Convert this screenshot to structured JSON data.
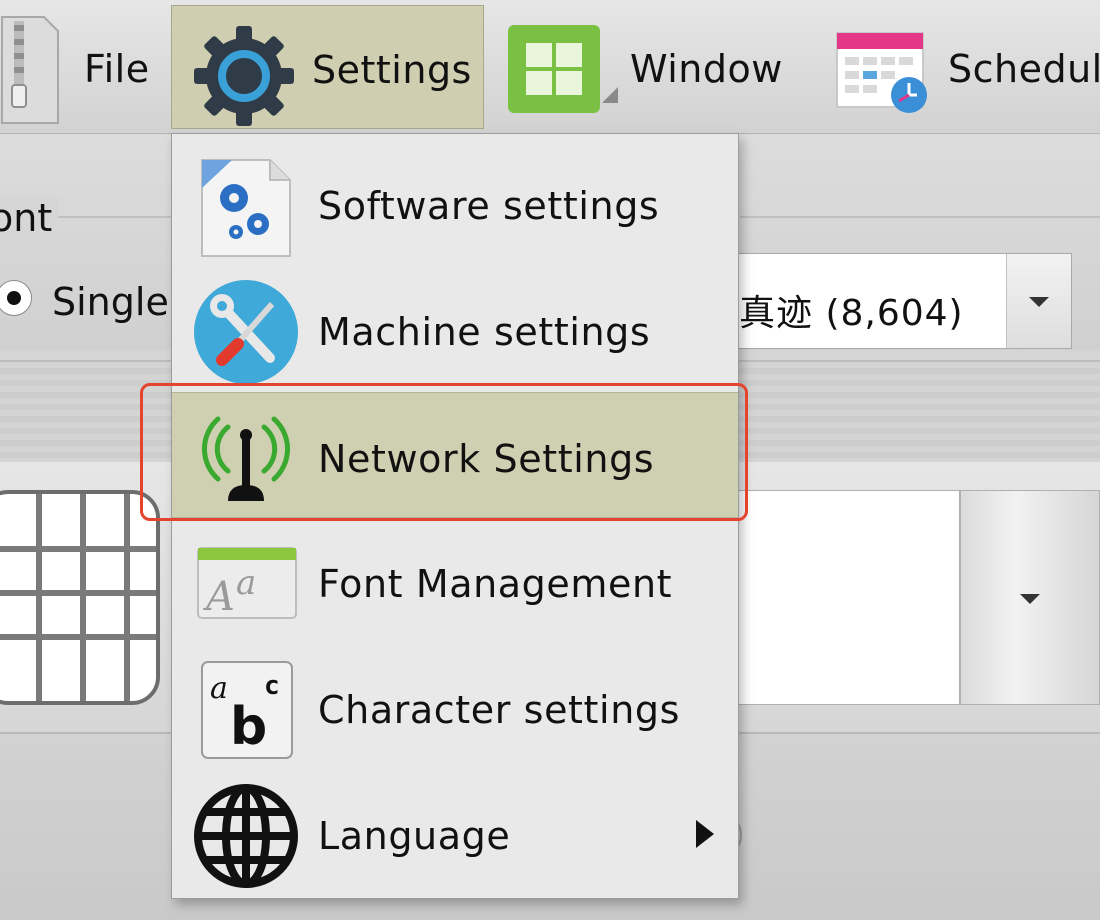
{
  "menubar": {
    "items": [
      {
        "label": "File",
        "icon": "zip-file-icon"
      },
      {
        "label": "Settings",
        "icon": "gear-icon",
        "active": true
      },
      {
        "label": "Window",
        "icon": "windows-logo-icon"
      },
      {
        "label": "Schedul",
        "icon": "calendar-clock-icon"
      }
    ]
  },
  "background": {
    "font_group_label": "ont",
    "radio_label": "Single",
    "font_combo_value": "真迹 (8,604)"
  },
  "settings_menu": {
    "items": [
      {
        "label": "Software settings",
        "icon": "software-gears-icon"
      },
      {
        "label": "Machine settings",
        "icon": "wrench-screwdriver-icon"
      },
      {
        "label": "Network Settings",
        "icon": "antenna-icon",
        "highlighted": true
      },
      {
        "label": "Font Management",
        "icon": "font-aa-icon"
      },
      {
        "label": "Character settings",
        "icon": "abc-icon"
      },
      {
        "label": "Language",
        "icon": "globe-icon",
        "has_submenu": true
      }
    ]
  },
  "colors": {
    "active_menu": "#cfcfb1",
    "callout": "#e2442f",
    "menu_bg": "#e9e9e9"
  }
}
